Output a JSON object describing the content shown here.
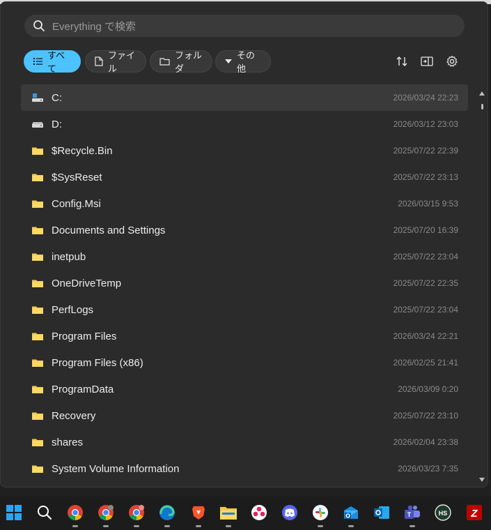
{
  "search": {
    "placeholder": "Everything で検索",
    "value": ""
  },
  "filters": [
    {
      "label": "すべて",
      "icon": "list-icon",
      "active": true
    },
    {
      "label": "ファイル",
      "icon": "file-icon",
      "active": false
    },
    {
      "label": "フォルダ",
      "icon": "folder-outline-icon",
      "active": false
    },
    {
      "label": "その他",
      "icon": "caret-down-icon",
      "active": false
    }
  ],
  "toolbar": {
    "sort_icon": "sort-icon",
    "preview_icon": "preview-pane-icon",
    "settings_icon": "gear-icon"
  },
  "results": [
    {
      "name": "C:",
      "date": "2026/03/24 22:23",
      "type": "drive-windows",
      "selected": true
    },
    {
      "name": "D:",
      "date": "2026/03/12 23:03",
      "type": "drive"
    },
    {
      "name": "$Recycle.Bin",
      "date": "2025/07/22 22:39",
      "type": "folder"
    },
    {
      "name": "$SysReset",
      "date": "2025/07/22 23:13",
      "type": "folder"
    },
    {
      "name": "Config.Msi",
      "date": "2026/03/15 9:53",
      "type": "folder"
    },
    {
      "name": "Documents and Settings",
      "date": "2025/07/20 16:39",
      "type": "folder"
    },
    {
      "name": "inetpub",
      "date": "2025/07/22 23:04",
      "type": "folder"
    },
    {
      "name": "OneDriveTemp",
      "date": "2025/07/22 22:35",
      "type": "folder"
    },
    {
      "name": "PerfLogs",
      "date": "2025/07/22 23:04",
      "type": "folder"
    },
    {
      "name": "Program Files",
      "date": "2026/03/24 22:21",
      "type": "folder"
    },
    {
      "name": "Program Files (x86)",
      "date": "2026/02/25 21:41",
      "type": "folder"
    },
    {
      "name": "ProgramData",
      "date": "2026/03/09 0:20",
      "type": "folder"
    },
    {
      "name": "Recovery",
      "date": "2025/07/22 23:10",
      "type": "folder"
    },
    {
      "name": "shares",
      "date": "2026/02/04 23:38",
      "type": "folder"
    },
    {
      "name": "System Volume Information",
      "date": "2026/03/23 7:35",
      "type": "folder"
    }
  ],
  "taskbar": [
    "windows-start-icon",
    "search-icon",
    "chrome-icon",
    "chrome-profile-icon",
    "chrome-alt-icon",
    "edge-icon",
    "brave-icon",
    "file-explorer-icon",
    "app-red-dots-icon",
    "discord-icon",
    "slack-icon",
    "outlook-new-icon",
    "outlook-icon",
    "teams-icon",
    "hs-app-icon",
    "filezilla-icon"
  ],
  "colors": {
    "accent": "#4cc2ff",
    "folder": "#f5c84c",
    "window_bg": "#2b2b2b"
  }
}
